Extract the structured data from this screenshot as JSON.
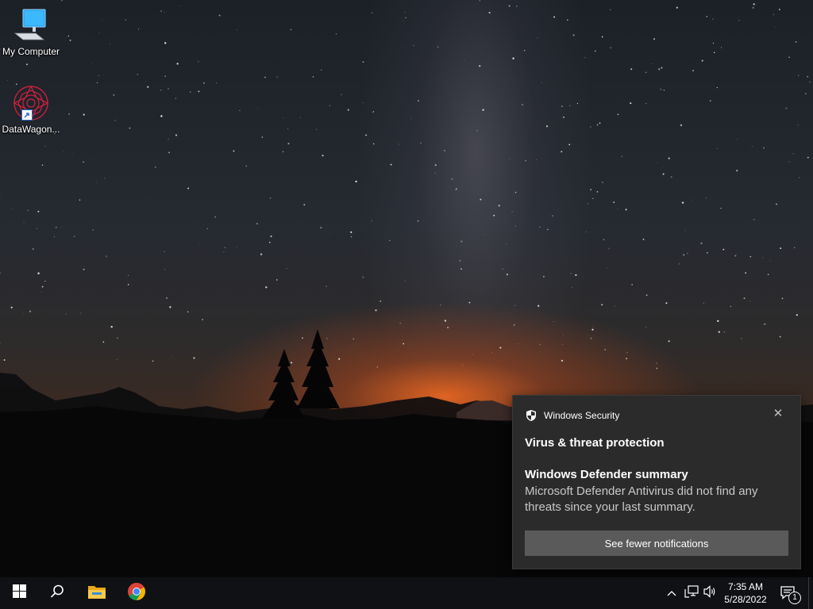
{
  "desktop": {
    "icons": [
      {
        "label": "My Computer",
        "icon": "computer-icon"
      },
      {
        "label": "DataWagon...",
        "icon": "datawagon-app-icon"
      }
    ]
  },
  "toast": {
    "app_name": "Windows Security",
    "close_glyph": "✕",
    "heading": "Virus & threat protection",
    "subheading": "Windows Defender summary",
    "message": "Microsoft Defender Antivirus did not find any threats since your last summary.",
    "action_label": "See fewer notifications"
  },
  "taskbar": {
    "apps": [
      "start-icon",
      "search-icon",
      "file-explorer-icon",
      "chrome-icon"
    ],
    "tray": {
      "chevron_glyph": "^",
      "time": "7:35 AM",
      "date": "5/28/2022",
      "notification_count": "1"
    }
  },
  "colors": {
    "taskbar_bg": "#101114",
    "toast_bg": "#2b2b2b",
    "action_bg": "#5a5a5a",
    "windows_blue": "#4cc2ff"
  }
}
